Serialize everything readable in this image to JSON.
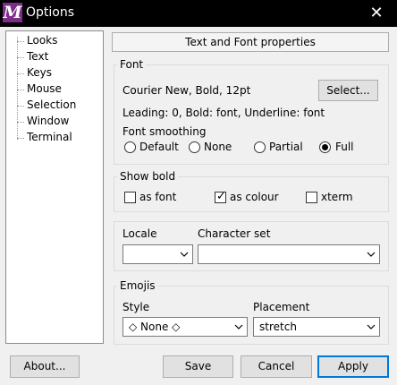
{
  "window": {
    "title": "Options",
    "app_icon": "M",
    "close": "✕"
  },
  "tree": {
    "items": [
      "Looks",
      "Text",
      "Keys",
      "Mouse",
      "Selection",
      "Window",
      "Terminal"
    ],
    "selected": "Text"
  },
  "header": "Text and Font properties",
  "font": {
    "group_label": "Font",
    "current": "Courier New, Bold, 12pt",
    "select_button": "Select...",
    "details": "Leading: 0, Bold: font, Underline: font",
    "smoothing_label": "Font smoothing",
    "smoothing_options": [
      "Default",
      "None",
      "Partial",
      "Full"
    ],
    "smoothing_selected": "Full"
  },
  "show_bold": {
    "group_label": "Show bold",
    "options": [
      {
        "label": "as font",
        "checked": false
      },
      {
        "label": "as colour",
        "checked": true
      },
      {
        "label": "xterm",
        "checked": false
      }
    ]
  },
  "locale": {
    "locale_label": "Locale",
    "locale_value": "",
    "charset_label": "Character set",
    "charset_value": ""
  },
  "emojis": {
    "group_label": "Emojis",
    "style_label": "Style",
    "style_value": "◇ None ◇",
    "placement_label": "Placement",
    "placement_value": "stretch"
  },
  "buttons": {
    "about": "About...",
    "save": "Save",
    "cancel": "Cancel",
    "apply": "Apply"
  },
  "colors": {
    "titlebar": "#000000",
    "app_icon": "#7b2e85",
    "focus": "#0078d7"
  }
}
